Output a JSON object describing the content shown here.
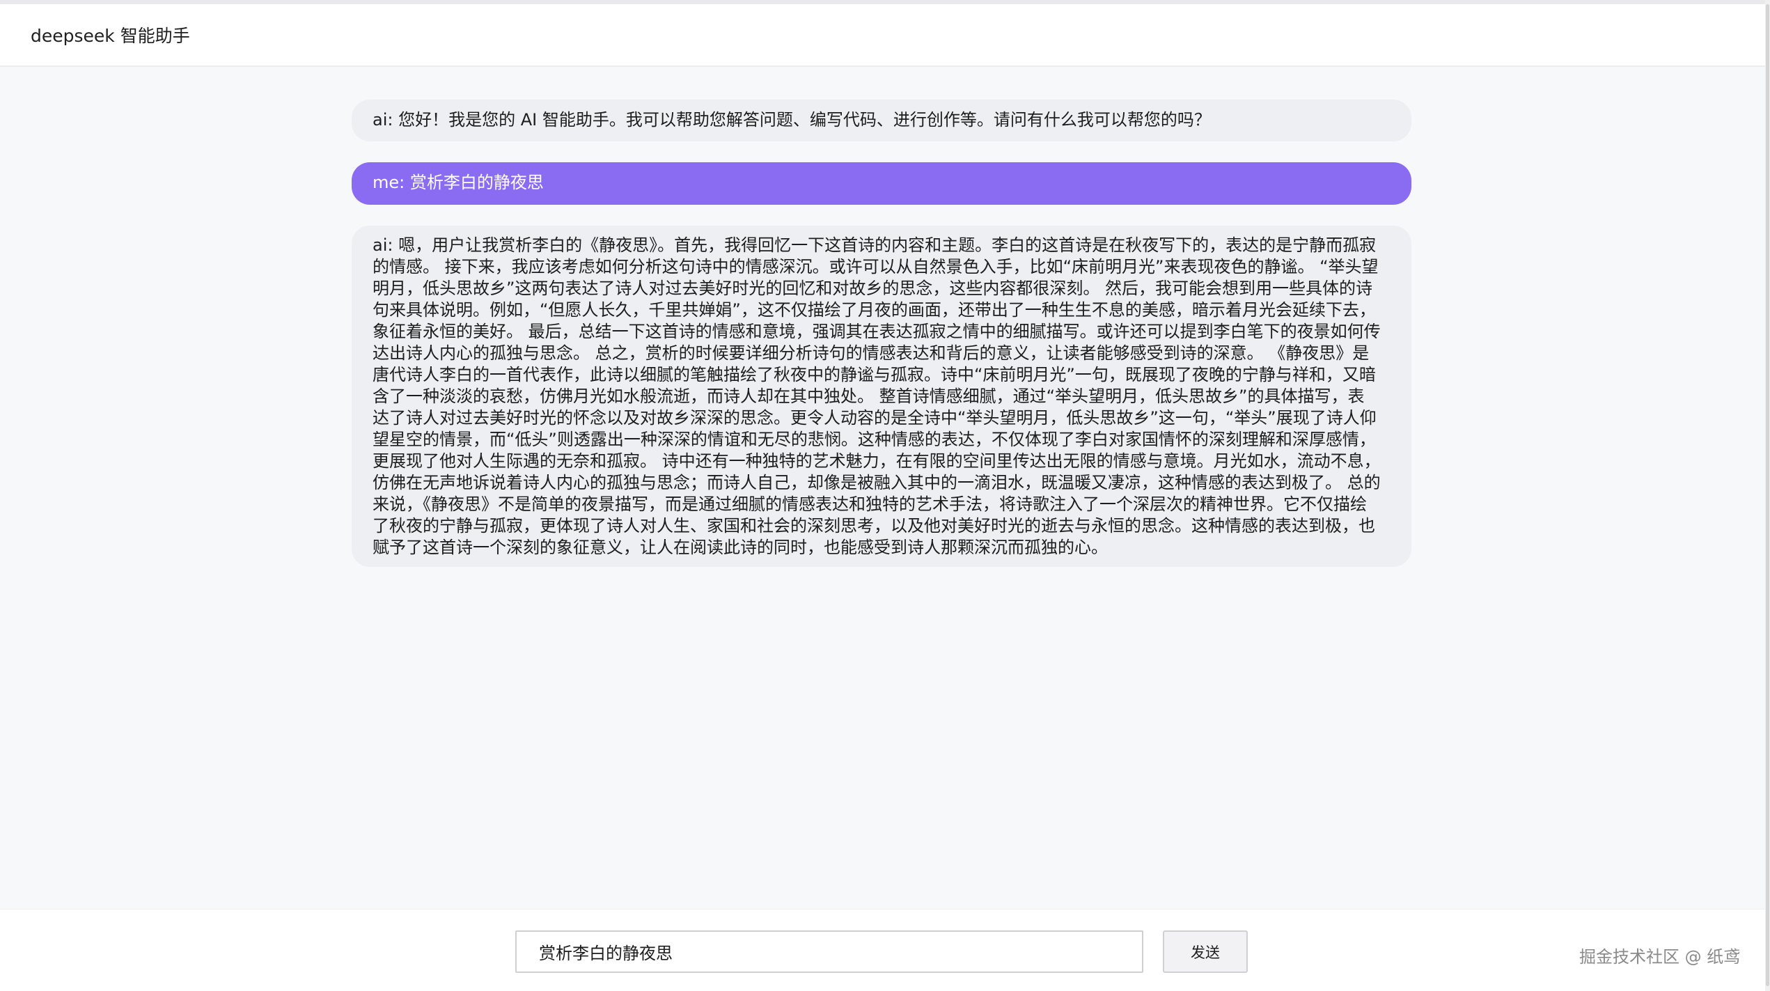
{
  "app": {
    "title": "deepseek 智能助手"
  },
  "messages": [
    {
      "role": "ai",
      "text": "ai: 您好！我是您的 AI 智能助手。我可以帮助您解答问题、编写代码、进行创作等。请问有什么我可以帮您的吗？"
    },
    {
      "role": "me",
      "text": "me: 赏析李白的静夜思"
    },
    {
      "role": "ai",
      "text": "ai: 嗯，用户让我赏析李白的《静夜思》。首先，我得回忆一下这首诗的内容和主题。李白的这首诗是在秋夜写下的，表达的是宁静而孤寂的情感。 接下来，我应该考虑如何分析这句诗中的情感深沉。或许可以从自然景色入手，比如“床前明月光”来表现夜色的静谧。 “举头望明月，低头思故乡”这两句表达了诗人对过去美好时光的回忆和对故乡的思念，这些内容都很深刻。 然后，我可能会想到用一些具体的诗句来具体说明。例如，“但愿人长久，千里共婵娟”，这不仅描绘了月夜的画面，还带出了一种生生不息的美感，暗示着月光会延续下去，象征着永恒的美好。 最后，总结一下这首诗的情感和意境，强调其在表达孤寂之情中的细腻描写。或许还可以提到李白笔下的夜景如何传达出诗人内心的孤独与思念。 总之，赏析的时候要详细分析诗句的情感表达和背后的意义，让读者能够感受到诗的深意。 《静夜思》是唐代诗人李白的一首代表作，此诗以细腻的笔触描绘了秋夜中的静谧与孤寂。诗中“床前明月光”一句，既展现了夜晚的宁静与祥和，又暗含了一种淡淡的哀愁，仿佛月光如水般流逝，而诗人却在其中独处。 整首诗情感细腻，通过“举头望明月，低头思故乡”的具体描写，表达了诗人对过去美好时光的怀念以及对故乡深深的思念。更令人动容的是全诗中“举头望明月，低头思故乡”这一句，“举头”展现了诗人仰望星空的情景，而“低头”则透露出一种深深的情谊和无尽的悲悯。这种情感的表达，不仅体现了李白对家国情怀的深刻理解和深厚感情，更展现了他对人生际遇的无奈和孤寂。 诗中还有一种独特的艺术魅力，在有限的空间里传达出无限的情感与意境。月光如水，流动不息，仿佛在无声地诉说着诗人内心的孤独与思念；而诗人自己，却像是被融入其中的一滴泪水，既温暖又凄凉，这种情感的表达到极了。 总的来说，《静夜思》不是简单的夜景描写，而是通过细腻的情感表达和独特的艺术手法，将诗歌注入了一个深层次的精神世界。它不仅描绘了秋夜的宁静与孤寂，更体现了诗人对人生、家国和社会的深刻思考，以及他对美好时光的逝去与永恒的思念。这种情感的表达到极，也赋予了这首诗一个深刻的象征意义，让人在阅读此诗的同时，也能感受到诗人那颗深沉而孤独的心。"
    }
  ],
  "composer": {
    "input_value": "赏析李白的静夜思",
    "send_label": "发送"
  },
  "watermark": "掘金技术社区 @ 纸鸢",
  "colors": {
    "user_bubble": "#8a6cf2",
    "ai_bubble": "#eeeff2",
    "page_background": "#f7f8fa"
  }
}
